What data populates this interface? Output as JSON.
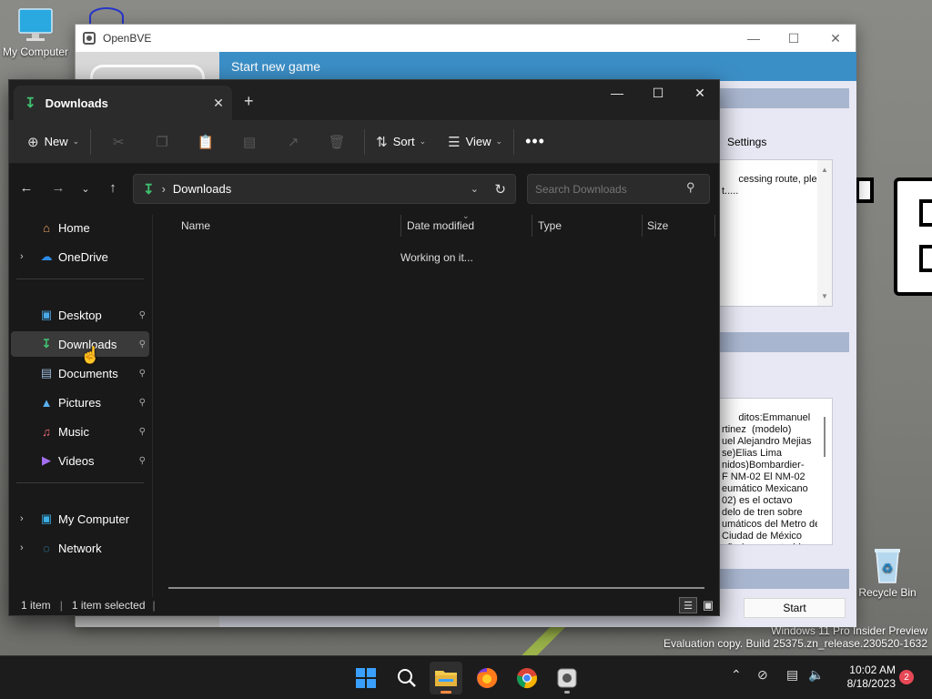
{
  "desktop": {
    "icons": [
      {
        "label": "My Computer",
        "icon": "computer-icon"
      },
      {
        "label": "Recycle Bin",
        "icon": "recycle-bin-icon"
      }
    ],
    "watermark": {
      "line1": "Windows 11 Pro Insider Preview",
      "line2": "Evaluation copy. Build 25375.zn_release.230520-1632"
    }
  },
  "openbve": {
    "title": "OpenBVE",
    "banner": "Start new game",
    "settings_tab": "Settings",
    "status_text": "cessing route, please\nt.....",
    "description": "ditos:Emmanuel\nrtinez  (modelo)\nuel Alejandro Mejias\nse)Elias Lima\nnidos)Bombardier-\nF NM-02 El NM-02\neumático Mexicano\n02) es el octavo\ndelo de tren sobre\numáticos del Metro de\nCiudad de México\neñado y construido",
    "start_button": "Start"
  },
  "explorer": {
    "tab_title": "Downloads",
    "toolbar": {
      "new_label": "New",
      "sort_label": "Sort",
      "view_label": "View"
    },
    "address": {
      "crumb": "Downloads",
      "search_placeholder": "Search Downloads"
    },
    "nav": {
      "home": "Home",
      "onedrive": "OneDrive",
      "desktop": "Desktop",
      "downloads": "Downloads",
      "documents": "Documents",
      "pictures": "Pictures",
      "music": "Music",
      "videos": "Videos",
      "my_computer": "My Computer",
      "network": "Network"
    },
    "columns": {
      "name": "Name",
      "date_modified": "Date modified",
      "type": "Type",
      "size": "Size"
    },
    "loading_text": "Working on it...",
    "status": {
      "items": "1 item",
      "selected": "1 item selected"
    }
  },
  "taskbar": {
    "time": "10:02 AM",
    "date": "8/18/2023",
    "notification_count": "2"
  },
  "colors": {
    "accent": "#3b8fc7",
    "explorer_bg": "#191919",
    "download_green": "#3fbf6f"
  }
}
